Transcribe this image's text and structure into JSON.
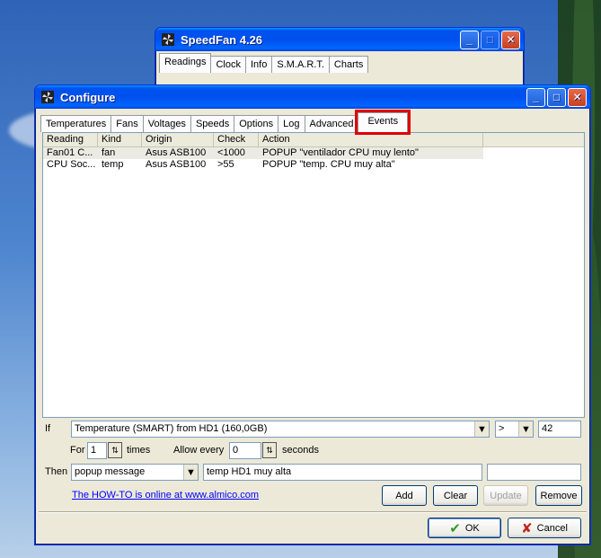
{
  "speedfan_window": {
    "title": "SpeedFan 4.26",
    "tabs": [
      "Readings",
      "Clock",
      "Info",
      "S.M.A.R.T.",
      "Charts"
    ],
    "active_tab": "Readings"
  },
  "configure_dialog": {
    "title": "Configure",
    "tabs": [
      "Temperatures",
      "Fans",
      "Voltages",
      "Speeds",
      "Options",
      "Log",
      "Advanced",
      "Events"
    ],
    "active_tab": "Events"
  },
  "events_list": {
    "columns": [
      "Reading",
      "Kind",
      "Origin",
      "Check",
      "Action"
    ],
    "rows": [
      {
        "reading": "Fan01 C...",
        "kind": "fan",
        "origin": "Asus ASB100",
        "check": "<1000",
        "action": "POPUP \"ventilador CPU muy lento\""
      },
      {
        "reading": "CPU Soc...",
        "kind": "temp",
        "origin": "Asus ASB100",
        "check": ">55",
        "action": "POPUP \"temp. CPU muy alta\""
      }
    ]
  },
  "editor": {
    "if_label": "If",
    "if_source": "Temperature (SMART) from HD1 (160,0GB)",
    "operator": ">",
    "threshold": "42",
    "for_label": "For",
    "for_value": "1",
    "times_label": "times",
    "allow_label": "Allow every",
    "allow_value": "0",
    "seconds_label": "seconds",
    "then_label": "Then",
    "then_action": "popup message",
    "then_param": "temp HD1 muy alta",
    "then_extra": ""
  },
  "howto_link": "The HOW-TO is online at www.almico.com",
  "buttons": {
    "add": "Add",
    "clear": "Clear",
    "update": "Update",
    "remove": "Remove",
    "ok": "OK",
    "cancel": "Cancel"
  },
  "colors": {
    "xp_title_blue": "#0053ee",
    "highlight_red": "#e00000",
    "link_blue": "#0000ff",
    "ok_check_green": "#2e9a2e",
    "cancel_x_red": "#c0261c"
  }
}
